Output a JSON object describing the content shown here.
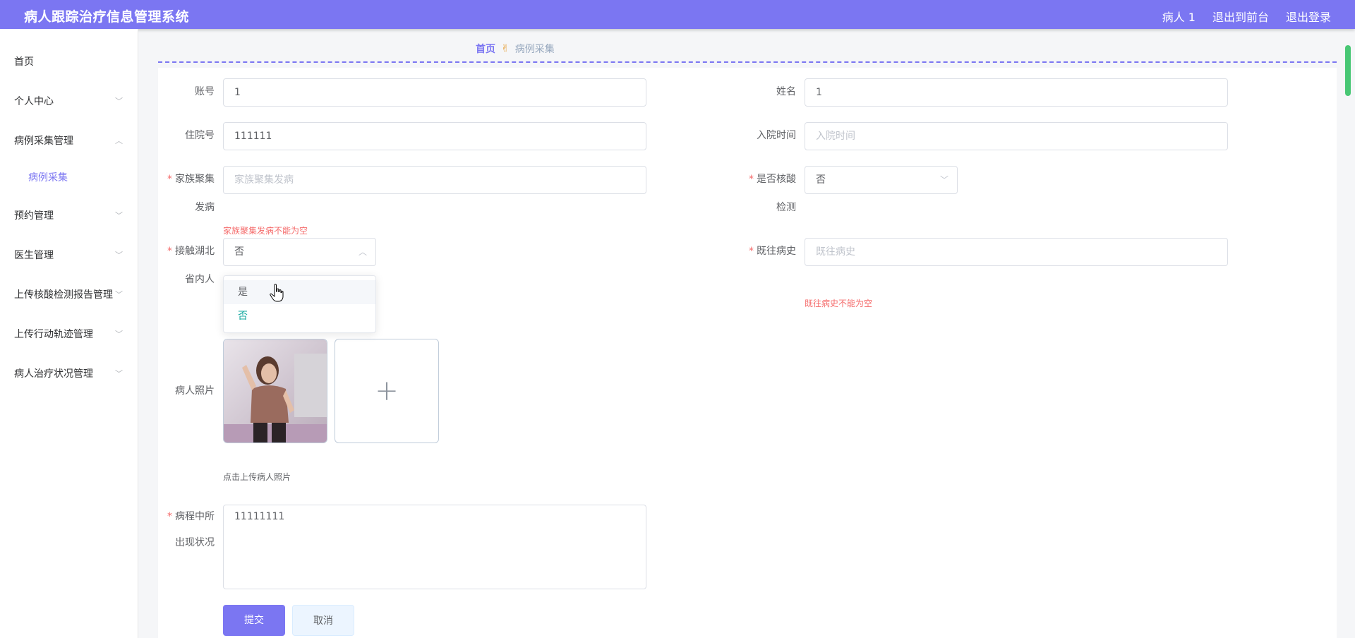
{
  "header": {
    "title": "病人跟踪治疗信息管理系统",
    "user": "病人 1",
    "front_link": "退出到前台",
    "logout_link": "退出登录"
  },
  "sidebar": {
    "items": [
      {
        "label": "首页"
      },
      {
        "label": "个人中心"
      },
      {
        "label": "病例采集管理"
      },
      {
        "label": "病例采集"
      },
      {
        "label": "预约管理"
      },
      {
        "label": "医生管理"
      },
      {
        "label": "上传核酸检测报告管理"
      },
      {
        "label": "上传行动轨迹管理"
      },
      {
        "label": "病人治疗状况管理"
      }
    ]
  },
  "breadcrumb": {
    "home": "首页",
    "current": "病例采集"
  },
  "form": {
    "account": {
      "label": "账号",
      "value": "1"
    },
    "name": {
      "label": "姓名",
      "value": "1"
    },
    "admission_no": {
      "label": "住院号",
      "value": "111111"
    },
    "admission_time": {
      "label": "入院时间",
      "placeholder": "入院时间"
    },
    "family_cluster": {
      "label_line1": "家族聚集",
      "label_line2": "发病",
      "placeholder": "家族聚集发病",
      "error": "家族聚集发病不能为空"
    },
    "nucleic_test": {
      "label_line1": "是否核酸",
      "label_line2": "检测",
      "value": "否"
    },
    "contact_hubei": {
      "label_line1": "接触湖北",
      "label_line2": "省内人",
      "value": "否",
      "options": [
        "是",
        "否"
      ]
    },
    "past_history": {
      "label": "既往病史",
      "placeholder": "既往病史",
      "error": "既往病史不能为空"
    },
    "photo": {
      "label": "病人照片",
      "hint": "点击上传病人照片",
      "add_symbol": "+"
    },
    "symptoms": {
      "label_line1": "病程中所",
      "label_line2": "出现状况",
      "value": "11111111"
    },
    "submit": "提交",
    "cancel": "取消"
  },
  "colors": {
    "primary": "#7b76f2",
    "error": "#f56c6c",
    "selected_option": "#13a89e"
  }
}
